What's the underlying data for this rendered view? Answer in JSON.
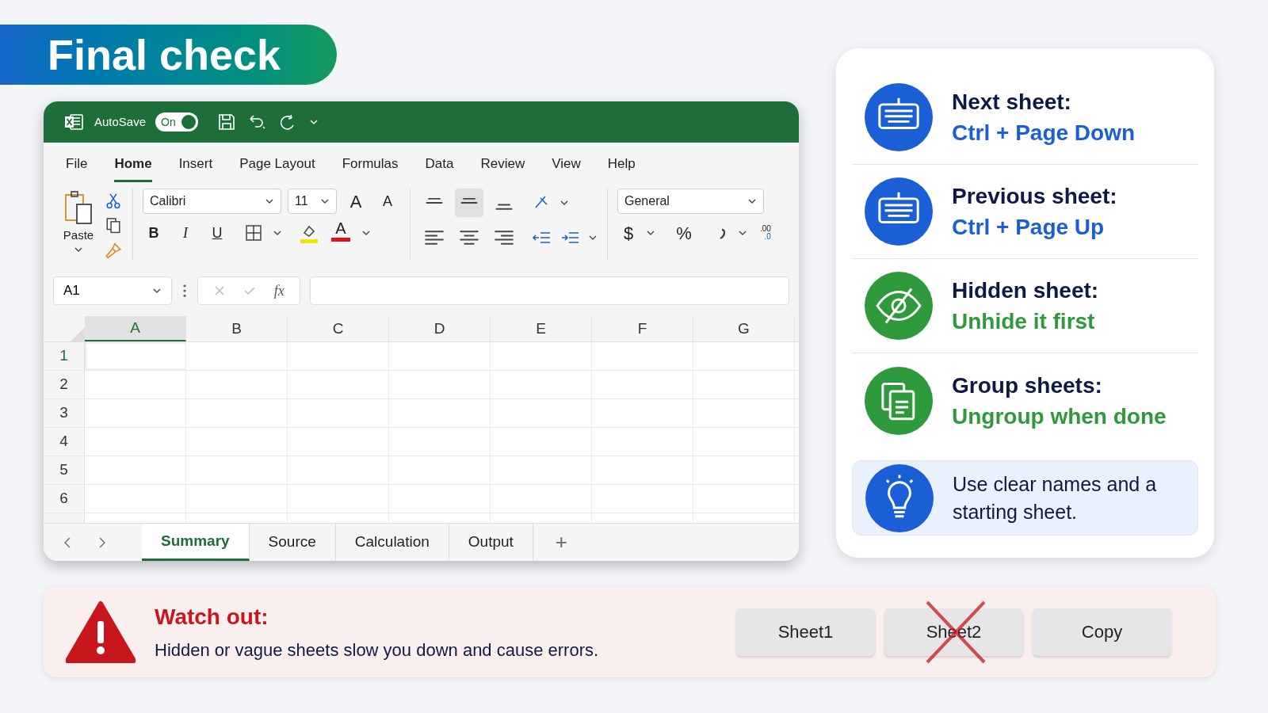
{
  "banner": {
    "title": "Final check"
  },
  "excel": {
    "autosave": {
      "label": "AutoSave",
      "toggle_label": "On",
      "on": true
    },
    "menu_tabs": [
      {
        "label": "File",
        "selected": false
      },
      {
        "label": "Home",
        "selected": true
      },
      {
        "label": "Insert",
        "selected": false
      },
      {
        "label": "Page Layout",
        "selected": false
      },
      {
        "label": "Formulas",
        "selected": false
      },
      {
        "label": "Data",
        "selected": false
      },
      {
        "label": "Review",
        "selected": false
      },
      {
        "label": "View",
        "selected": false
      },
      {
        "label": "Help",
        "selected": false
      }
    ],
    "ribbon": {
      "paste": "Paste",
      "font": "Calibri",
      "size": "11",
      "grow": "A",
      "shrink": "A",
      "bold": "B",
      "italic": "I",
      "underline": "U",
      "font_color": "A",
      "center_align_selected": true,
      "number_format": "General",
      "currency": "$",
      "percent": "%",
      "decimal_top": ".00",
      "decimal_bottom": ".0"
    },
    "name_box": "A1",
    "fx": "fx",
    "columns": [
      {
        "label": "A",
        "selected": true
      },
      {
        "label": "B",
        "selected": false
      },
      {
        "label": "C",
        "selected": false
      },
      {
        "label": "D",
        "selected": false
      },
      {
        "label": "E",
        "selected": false
      },
      {
        "label": "F",
        "selected": false
      },
      {
        "label": "G",
        "selected": false
      }
    ],
    "rows": [
      {
        "label": "1",
        "selected": true
      },
      {
        "label": "2",
        "selected": false
      },
      {
        "label": "3",
        "selected": false
      },
      {
        "label": "4",
        "selected": false
      },
      {
        "label": "5",
        "selected": false
      },
      {
        "label": "6",
        "selected": false
      }
    ],
    "sheet_tabs": [
      {
        "label": "Summary",
        "selected": true
      },
      {
        "label": "Source",
        "selected": false
      },
      {
        "label": "Calculation",
        "selected": false
      },
      {
        "label": "Output",
        "selected": false
      }
    ],
    "add_sheet": "+"
  },
  "tips": [
    {
      "kind": "shortcut",
      "title": "Next sheet:",
      "detail": "Ctrl + Page Down",
      "color": "#1a5fd6"
    },
    {
      "kind": "shortcut",
      "title": "Previous sheet:",
      "detail": "Ctrl + Page Up",
      "color": "#1a5fd6"
    },
    {
      "kind": "shortcut",
      "title": "Hidden sheet:",
      "detail": "Unhide it first",
      "color": "#2e9a3c"
    },
    {
      "kind": "shortcut",
      "title": "Group sheets:",
      "detail": "Ungroup when done",
      "color": "#2e9a3c"
    },
    {
      "kind": "tip",
      "text": "Use clear names and a starting sheet.",
      "color": "#1a5fd6"
    }
  ],
  "warning": {
    "title": "Watch out:",
    "text": "Hidden or vague sheets slow you down and cause errors.",
    "sheets": [
      {
        "label": "Sheet1",
        "crossed": false
      },
      {
        "label": "Sheet2",
        "crossed": true
      },
      {
        "label": "Copy",
        "crossed": false
      }
    ]
  }
}
